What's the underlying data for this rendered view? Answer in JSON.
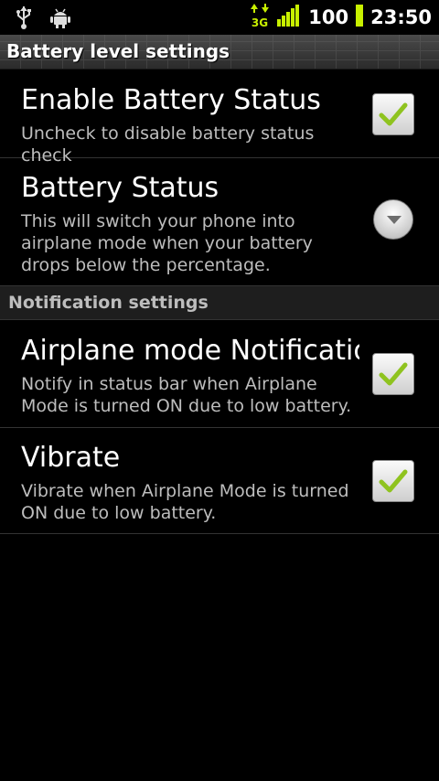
{
  "status_bar": {
    "battery_level": "100",
    "time": "23:50",
    "network": "3G",
    "icons": [
      "usb-icon",
      "android-debug-icon",
      "data-3g-icon",
      "signal-icon",
      "battery-icon"
    ]
  },
  "title_bar": {
    "title": "Battery level settings"
  },
  "prefs": [
    {
      "title": "Enable Battery Status",
      "summary": "Uncheck to disable battery status check",
      "checked": true
    },
    {
      "title": "Battery Status",
      "summary": "This will switch your phone into airplane mode when your battery drops below the percentage."
    }
  ],
  "category": {
    "label": "Notification settings"
  },
  "notification_prefs": [
    {
      "title": "Airplane mode Notification",
      "summary": "Notify in status bar when Airplane Mode is turned ON due to low battery.",
      "checked": true
    },
    {
      "title": "Vibrate",
      "summary": "Vibrate when Airplane Mode is turned ON due to low battery.",
      "checked": true
    }
  ],
  "colors": {
    "check": "#8fc31f",
    "accent_battery": "#c8f000"
  }
}
